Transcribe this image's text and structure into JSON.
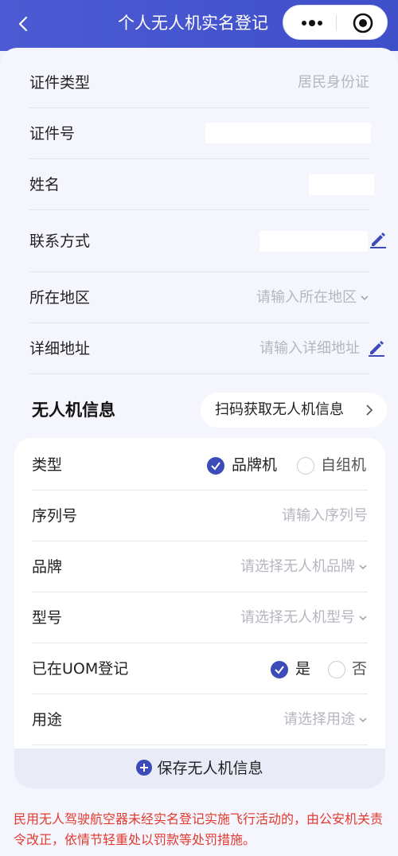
{
  "header": {
    "title": "个人无人机实名登记"
  },
  "personal": {
    "id_type": {
      "label": "证件类型",
      "value": "居民身份证"
    },
    "id_number": {
      "label": "证件号"
    },
    "name": {
      "label": "姓名"
    },
    "contact": {
      "label": "联系方式"
    },
    "region": {
      "label": "所在地区",
      "placeholder": "请输入所在地区"
    },
    "address": {
      "label": "详细地址",
      "placeholder": "请输入详细地址"
    }
  },
  "drone": {
    "section_title": "无人机信息",
    "scan_button": "扫码获取无人机信息",
    "type": {
      "label": "类型",
      "options": [
        "品牌机",
        "自组机"
      ],
      "selected": "品牌机"
    },
    "serial": {
      "label": "序列号",
      "placeholder": "请输入序列号"
    },
    "brand": {
      "label": "品牌",
      "placeholder": "请选择无人机品牌"
    },
    "model": {
      "label": "型号",
      "placeholder": "请选择无人机型号"
    },
    "uom": {
      "label": "已在UOM登记",
      "options": [
        "是",
        "否"
      ],
      "selected": "是"
    },
    "usage": {
      "label": "用途",
      "placeholder": "请选择用途"
    },
    "save_button": "保存无人机信息"
  },
  "warning": "民用无人驾驶航空器未经实名登记实施飞行活动的，由公安机关责令改正，依情节轻重处以罚款等处罚措施。",
  "colors": {
    "accent": "#3c4bb8",
    "header": "#4c5bd3",
    "warning": "#e03a2f"
  }
}
